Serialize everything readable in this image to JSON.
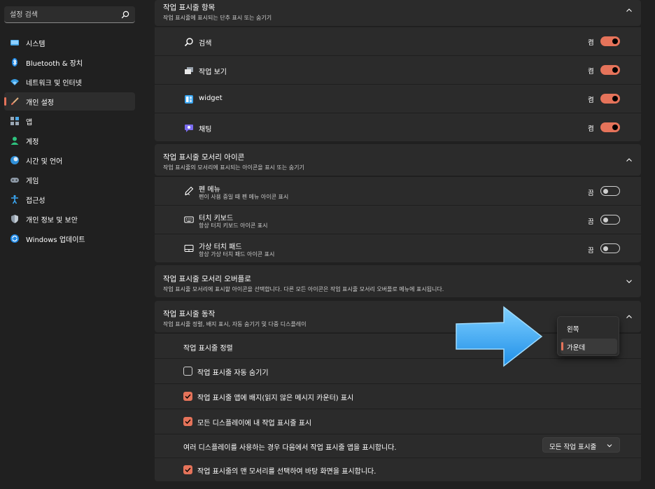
{
  "colors": {
    "accent": "#e5735a",
    "background": "#202020",
    "card": "#2b2b2b",
    "arrow": "#3aa6f2"
  },
  "sidebar": {
    "search_placeholder": "설정 검색",
    "items": [
      {
        "label": "시스템",
        "icon": "monitor-icon"
      },
      {
        "label": "Bluetooth & 장치",
        "icon": "bluetooth-icon"
      },
      {
        "label": "네트워크 및 인터넷",
        "icon": "wifi-icon"
      },
      {
        "label": "개인 설정",
        "icon": "brush-icon",
        "active": true
      },
      {
        "label": "앱",
        "icon": "apps-icon"
      },
      {
        "label": "계정",
        "icon": "person-icon"
      },
      {
        "label": "시간 및 언어",
        "icon": "globe-clock-icon"
      },
      {
        "label": "게임",
        "icon": "gamepad-icon"
      },
      {
        "label": "접근성",
        "icon": "accessibility-icon"
      },
      {
        "label": "개인 정보 및 보안",
        "icon": "shield-icon"
      },
      {
        "label": "Windows 업데이트",
        "icon": "update-icon"
      }
    ]
  },
  "taskbar_items": {
    "title": "작업 표시줄 항목",
    "subtitle": "작업 표시줄에 표시되는 단추 표시 또는 숨기기",
    "rows": [
      {
        "label": "검색",
        "state": "켬",
        "on": true,
        "icon": "search-icon"
      },
      {
        "label": "작업 보기",
        "state": "켬",
        "on": true,
        "icon": "task-view-icon"
      },
      {
        "label": "widget",
        "state": "켬",
        "on": true,
        "icon": "widgets-icon"
      },
      {
        "label": "채팅",
        "state": "켬",
        "on": true,
        "icon": "chat-icon"
      }
    ]
  },
  "corner_icons": {
    "title": "작업 표시줄 모서리 아이콘",
    "subtitle": "작업 표시줄의 모서리에 표시되는 아이콘을 표시 또는 숨기기",
    "rows": [
      {
        "label": "펜 메뉴",
        "sub": "펜이 사용 중일 때 펜 메뉴 아이콘 표시",
        "state": "끔",
        "on": false,
        "icon": "pen-icon"
      },
      {
        "label": "터치 키보드",
        "sub": "항상 터치 키보드 아이콘 표시",
        "state": "끔",
        "on": false,
        "icon": "keyboard-icon"
      },
      {
        "label": "가상 터치 패드",
        "sub": "항상 가상 터치 패드 아이콘 표시",
        "state": "끔",
        "on": false,
        "icon": "touchpad-icon"
      }
    ]
  },
  "corner_overflow": {
    "title": "작업 표시줄 모서리 오버플로",
    "subtitle": "작업 표시줄 모서리에 표시할 아이콘을 선택합니다. 다른 모든 아이콘은 작업 표시줄 모서리 오버플로 메뉴에 표시됩니다."
  },
  "behaviors": {
    "title": "작업 표시줄 동작",
    "subtitle": "작업 표시줄 정렬, 배지 표시, 자동 숨기기 및 다중 디스플레이",
    "alignment_label": "작업 표시줄 정렬",
    "auto_hide_label": "작업 표시줄 자동 숨기기",
    "badges_label": "작업 표시줄 앱에 배지(읽지 않은 메시지 카운터) 표시",
    "all_displays_label": "모든 디스플레이에 내 작업 표시줄 표시",
    "multi_display_label": "여러 디스플레이를 사용하는 경우 다음에서 작업 표시줄 앱을 표시합니다.",
    "multi_display_value": "모든 작업 표시줄",
    "far_corner_label": "작업 표시줄의 맨 모서리를 선택하여 바탕 화면을 표시합니다.",
    "auto_hide": false,
    "badges": true,
    "all_displays": true,
    "far_corner": true
  },
  "alignment_popup": {
    "options": [
      "왼쪽",
      "가운데"
    ],
    "selected": "가운데"
  }
}
